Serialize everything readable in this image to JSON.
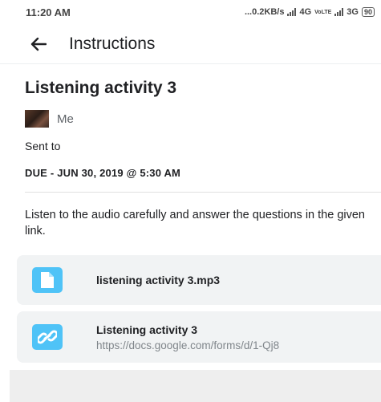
{
  "status_bar": {
    "time": "11:20 AM",
    "network_speed": "...0.2KB/s",
    "net1": "4G",
    "volte": "VoLTE",
    "net2": "3G",
    "battery": "90"
  },
  "app_bar": {
    "title": "Instructions"
  },
  "post": {
    "title": "Listening activity 3",
    "author": "Me",
    "sent_to": "Sent to",
    "due": "DUE - JUN 30, 2019 @ 5:30 AM",
    "description": "Listen to the audio carefully and answer the questions in the given link."
  },
  "attachments": [
    {
      "title": "listening activity 3.mp3",
      "subtitle": "",
      "icon": "file-icon"
    },
    {
      "title": "Listening activity 3",
      "subtitle": "https://docs.google.com/forms/d/1-Qj8",
      "icon": "link-icon"
    }
  ],
  "colors": {
    "accent": "#4fc3f7",
    "card_bg": "#f1f3f4",
    "muted_text": "#80868b"
  }
}
